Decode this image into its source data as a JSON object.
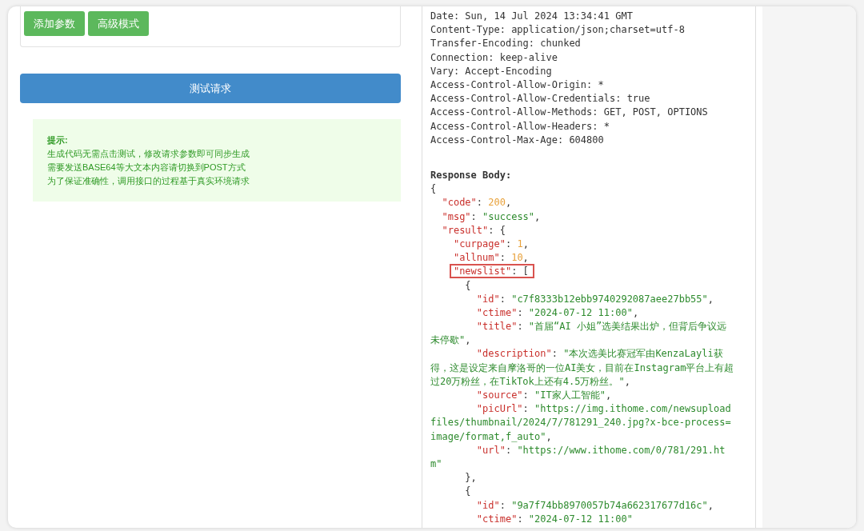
{
  "params": {
    "buttons": [
      {
        "label": "添加参数"
      },
      {
        "label": "高级模式"
      }
    ]
  },
  "submit_button": {
    "label": "测试请求"
  },
  "hint": {
    "title": "提示:",
    "lines": [
      "生成代码无需点击测试，修改请求参数即可同步生成",
      "需要发送BASE64等大文本内容请切换到POST方式",
      "为了保证准确性，调用接口的过程基于真实环境请求"
    ]
  },
  "response": {
    "headers": [
      "Date: Sun, 14 Jul 2024 13:34:41 GMT",
      "Content-Type: application/json;charset=utf-8",
      "Transfer-Encoding: chunked",
      "Connection: keep-alive",
      "Vary: Accept-Encoding",
      "Access-Control-Allow-Origin: *",
      "Access-Control-Allow-Credentials: true",
      "Access-Control-Allow-Methods: GET, POST, OPTIONS",
      "Access-Control-Allow-Headers: *",
      "Access-Control-Max-Age: 604800"
    ],
    "body_label": "Response Body:",
    "body_lines": [
      {
        "highlighted": false,
        "tokens": [
          {
            "kind": "punct",
            "text": "{"
          }
        ]
      },
      {
        "highlighted": false,
        "tokens": [
          {
            "kind": "key",
            "text": "  \"code\""
          },
          {
            "kind": "punct",
            "text": ": "
          },
          {
            "kind": "number",
            "text": "200"
          },
          {
            "kind": "punct",
            "text": ","
          }
        ]
      },
      {
        "highlighted": false,
        "tokens": [
          {
            "kind": "key",
            "text": "  \"msg\""
          },
          {
            "kind": "punct",
            "text": ": "
          },
          {
            "kind": "string",
            "text": "\"success\""
          },
          {
            "kind": "punct",
            "text": ","
          }
        ]
      },
      {
        "highlighted": false,
        "tokens": [
          {
            "kind": "key",
            "text": "  \"result\""
          },
          {
            "kind": "punct",
            "text": ": {"
          }
        ]
      },
      {
        "highlighted": false,
        "tokens": [
          {
            "kind": "key",
            "text": "    \"curpage\""
          },
          {
            "kind": "punct",
            "text": ": "
          },
          {
            "kind": "number",
            "text": "1"
          },
          {
            "kind": "punct",
            "text": ","
          }
        ]
      },
      {
        "highlighted": false,
        "tokens": [
          {
            "kind": "key",
            "text": "    \"allnum\""
          },
          {
            "kind": "punct",
            "text": ": "
          },
          {
            "kind": "number",
            "text": "10"
          },
          {
            "kind": "punct",
            "text": ","
          }
        ]
      },
      {
        "highlighted": true,
        "tokens": [
          {
            "kind": "key",
            "text": "    \"newslist\""
          },
          {
            "kind": "punct",
            "text": ": ["
          }
        ]
      },
      {
        "highlighted": false,
        "tokens": [
          {
            "kind": "punct",
            "text": "      {"
          }
        ]
      },
      {
        "highlighted": false,
        "tokens": [
          {
            "kind": "key",
            "text": "        \"id\""
          },
          {
            "kind": "punct",
            "text": ": "
          },
          {
            "kind": "string",
            "text": "\"c7f8333b12ebb9740292087aee27bb55\""
          },
          {
            "kind": "punct",
            "text": ","
          }
        ]
      },
      {
        "highlighted": false,
        "tokens": [
          {
            "kind": "key",
            "text": "        \"ctime\""
          },
          {
            "kind": "punct",
            "text": ": "
          },
          {
            "kind": "string",
            "text": "\"2024-07-12 11:00\""
          },
          {
            "kind": "punct",
            "text": ","
          }
        ]
      },
      {
        "highlighted": false,
        "tokens": [
          {
            "kind": "key",
            "text": "        \"title\""
          },
          {
            "kind": "punct",
            "text": ": "
          },
          {
            "kind": "string",
            "text": "\"首届“AI 小姐”选美结果出炉，但背后争议远"
          }
        ]
      },
      {
        "highlighted": false,
        "tokens": [
          {
            "kind": "string",
            "text": "未停歇\""
          },
          {
            "kind": "punct",
            "text": ","
          }
        ]
      },
      {
        "highlighted": false,
        "tokens": [
          {
            "kind": "key",
            "text": "        \"description\""
          },
          {
            "kind": "punct",
            "text": ": "
          },
          {
            "kind": "string",
            "text": "\"本次选美比赛冠军由KenzaLayli获"
          }
        ]
      },
      {
        "highlighted": false,
        "tokens": [
          {
            "kind": "string",
            "text": "得，这是设定来自摩洛哥的一位AI美女，目前在Instagram平台上有超"
          }
        ]
      },
      {
        "highlighted": false,
        "tokens": [
          {
            "kind": "string",
            "text": "过20万粉丝，在TikTok上还有4.5万粉丝。\""
          },
          {
            "kind": "punct",
            "text": ","
          }
        ]
      },
      {
        "highlighted": false,
        "tokens": [
          {
            "kind": "key",
            "text": "        \"source\""
          },
          {
            "kind": "punct",
            "text": ": "
          },
          {
            "kind": "string",
            "text": "\"IT家人工智能\""
          },
          {
            "kind": "punct",
            "text": ","
          }
        ]
      },
      {
        "highlighted": false,
        "tokens": [
          {
            "kind": "key",
            "text": "        \"picUrl\""
          },
          {
            "kind": "punct",
            "text": ": "
          },
          {
            "kind": "string",
            "text": "\"https://img.ithome.com/newsupload"
          }
        ]
      },
      {
        "highlighted": false,
        "tokens": [
          {
            "kind": "string",
            "text": "files/thumbnail/2024/7/781291_240.jpg?x-bce-process="
          }
        ]
      },
      {
        "highlighted": false,
        "tokens": [
          {
            "kind": "string",
            "text": "image/format,f_auto\""
          },
          {
            "kind": "punct",
            "text": ","
          }
        ]
      },
      {
        "highlighted": false,
        "tokens": [
          {
            "kind": "key",
            "text": "        \"url\""
          },
          {
            "kind": "punct",
            "text": ": "
          },
          {
            "kind": "string",
            "text": "\"https://www.ithome.com/0/781/291.ht"
          }
        ]
      },
      {
        "highlighted": false,
        "tokens": [
          {
            "kind": "string",
            "text": "m\""
          }
        ]
      },
      {
        "highlighted": false,
        "tokens": [
          {
            "kind": "punct",
            "text": "      },"
          }
        ]
      },
      {
        "highlighted": false,
        "tokens": [
          {
            "kind": "punct",
            "text": "      {"
          }
        ]
      },
      {
        "highlighted": false,
        "tokens": [
          {
            "kind": "key",
            "text": "        \"id\""
          },
          {
            "kind": "punct",
            "text": ": "
          },
          {
            "kind": "string",
            "text": "\"9a7f74bb8970057b74a662317677d16c\""
          },
          {
            "kind": "punct",
            "text": ","
          }
        ]
      },
      {
        "highlighted": false,
        "tokens": [
          {
            "kind": "key",
            "text": "        \"ctime\""
          },
          {
            "kind": "punct",
            "text": ": "
          },
          {
            "kind": "string",
            "text": "\"2024-07-12 11:00\""
          }
        ]
      }
    ]
  }
}
